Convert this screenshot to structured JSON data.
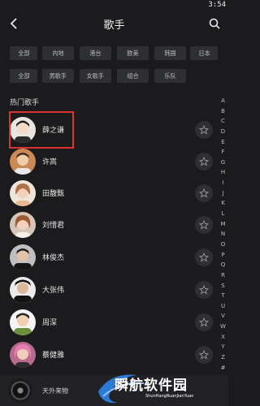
{
  "status": {
    "time": "3:54"
  },
  "header": {
    "title": "歌手",
    "back_icon": "back-arrow-icon",
    "search_icon": "search-icon"
  },
  "filters": {
    "row1": [
      "全部",
      "内地",
      "港台",
      "欧美",
      "韩国",
      "日本"
    ],
    "row2": [
      "全部",
      "男歌手",
      "女歌手",
      "组合",
      "乐队"
    ]
  },
  "section": {
    "title": "热门歌手"
  },
  "artists": [
    {
      "name": "薛之谦",
      "avatar_color": "#e9e4df"
    },
    {
      "name": "许嵩",
      "avatar_color": "#d9a06b"
    },
    {
      "name": "田馥甄",
      "avatar_color": "#e7b894"
    },
    {
      "name": "刘惜君",
      "avatar_color": "#c98f6a"
    },
    {
      "name": "林俊杰",
      "avatar_color": "#c7c7c7"
    },
    {
      "name": "大张伟",
      "avatar_color": "#2b2b2b"
    },
    {
      "name": "周深",
      "avatar_color": "#d6e0ea"
    },
    {
      "name": "蔡健雅",
      "avatar_color": "#e98ab9"
    }
  ],
  "index_letters": [
    "A",
    "B",
    "C",
    "D",
    "E",
    "F",
    "G",
    "H",
    "I",
    "J",
    "K",
    "L",
    "M",
    "N",
    "O",
    "P",
    "Q",
    "R",
    "S",
    "T",
    "U",
    "V",
    "W",
    "X",
    "Y",
    "Z",
    "#"
  ],
  "mini_player": {
    "title": "天外来物"
  },
  "watermark": {
    "text": "瞬航软件园",
    "subtext": "ShunHangRuanJianYuan"
  },
  "colors": {
    "background": "#1b1b1d",
    "chip": "#2e2f33",
    "highlight": "#d9342f"
  }
}
